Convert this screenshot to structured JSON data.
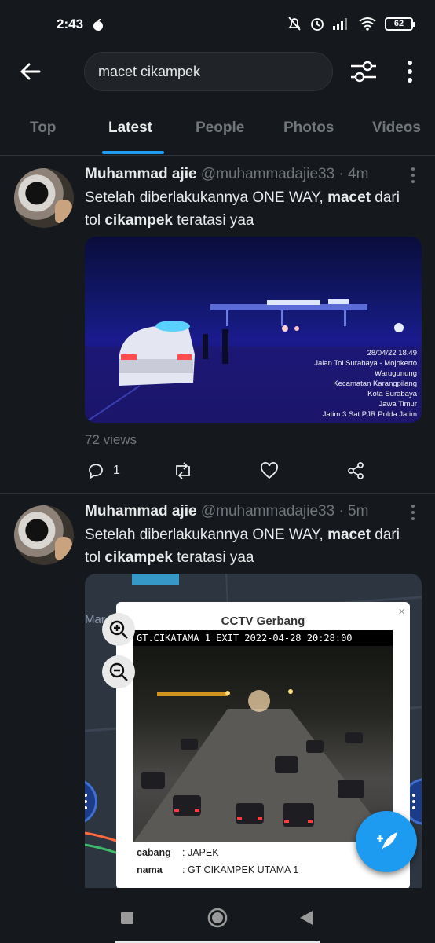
{
  "status_bar": {
    "time": "2:43",
    "battery": "62"
  },
  "search": {
    "query": "macet cikampek"
  },
  "tabs": [
    {
      "label": "Top",
      "active": false
    },
    {
      "label": "Latest",
      "active": true
    },
    {
      "label": "People",
      "active": false
    },
    {
      "label": "Photos",
      "active": false
    },
    {
      "label": "Videos",
      "active": false
    }
  ],
  "tweets": [
    {
      "name": "Muhammad ajie",
      "handle": "@muhammadajie33",
      "time": "· 4m",
      "text_parts": [
        "Setelah diberlakukannya ONE WAY, ",
        "macet",
        " dari tol ",
        "cikampek",
        " teratasi yaa"
      ],
      "media_overlay": [
        "28/04/22 18.49",
        "Jalan Tol Surabaya - Mojokerto",
        "Warugunung",
        "Kecamatan Karangpilang",
        "Kota Surabaya",
        "Jawa Timur",
        "Jatim 3 Sat PJR Polda Jatim"
      ],
      "views": "72 views",
      "reply_count": "1"
    },
    {
      "name": "Muhammad ajie",
      "handle": "@muhammadajie33",
      "time": "· 5m",
      "text_parts": [
        "Setelah diberlakukannya ONE WAY, ",
        "macet",
        " dari tol ",
        "cikampek",
        " teratasi yaa"
      ],
      "map_label": "Mar",
      "popup": {
        "title": "CCTV Gerbang",
        "close": "×",
        "cam_label": "GT.CIKATAMA 1 EXIT 2022-04-28 20:28:00",
        "cabang_key": "cabang",
        "cabang_value": ": JAPEK",
        "nama_key": "nama",
        "nama_value": ": GT CIKAMPEK UTAMA 1"
      }
    }
  ],
  "colors": {
    "accent": "#1d9bf0",
    "background": "#15181c",
    "muted": "#71767b"
  },
  "icons": [
    "back-arrow-icon",
    "filter-icon",
    "more-vertical-icon",
    "reply-icon",
    "retweet-icon",
    "like-icon",
    "share-icon",
    "zoom-in-icon",
    "zoom-out-icon",
    "compose-icon"
  ]
}
